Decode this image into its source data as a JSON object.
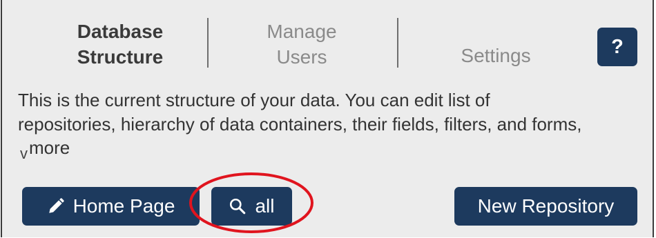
{
  "tabs": {
    "database_structure": {
      "line1": "Database",
      "line2": "Structure"
    },
    "manage_users": {
      "line1": "Manage",
      "line2": "Users"
    },
    "settings": {
      "label": "Settings"
    }
  },
  "help_button": {
    "label": "?"
  },
  "description": {
    "line1": "This is the current structure of your data. You can edit list of",
    "line2": "repositories, hierarchy of data containers, their fields, filters, and forms,"
  },
  "more_link": {
    "caret": "v",
    "label": "more"
  },
  "buttons": {
    "home_page": {
      "label": "Home Page",
      "icon": "pencil-icon"
    },
    "search_all": {
      "label": "all",
      "icon": "search-icon"
    },
    "new_repository": {
      "label": "New Repository"
    }
  },
  "annotation": {
    "color": "#e0141e"
  },
  "colors": {
    "button_bg": "#1d3a5e",
    "panel_bg": "#ececec",
    "border": "#3b3b3b"
  }
}
